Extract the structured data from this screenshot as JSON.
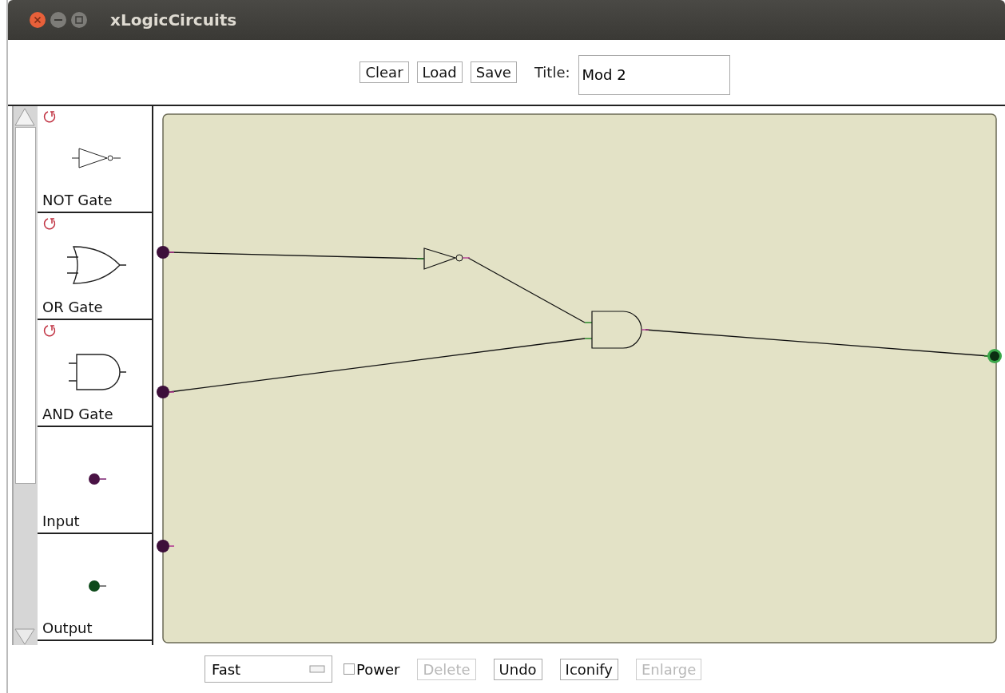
{
  "window": {
    "title": "xLogicCircuits"
  },
  "toolbar": {
    "buttons": [
      "Clear",
      "Load",
      "Save"
    ],
    "title_label": "Title:",
    "title_value": "Mod 2"
  },
  "palette": [
    {
      "kind": "not",
      "label": "NOT Gate",
      "rotatable": true
    },
    {
      "kind": "or",
      "label": "OR Gate",
      "rotatable": true
    },
    {
      "kind": "and",
      "label": "AND Gate",
      "rotatable": true
    },
    {
      "kind": "input",
      "label": "Input",
      "rotatable": false
    },
    {
      "kind": "output",
      "label": "Output",
      "rotatable": false
    }
  ],
  "bottom_bar": {
    "speed": "Fast",
    "power": {
      "label": "Power",
      "checked": false
    },
    "buttons": [
      {
        "label": "Delete",
        "disabled": true
      },
      {
        "label": "Undo",
        "disabled": false
      },
      {
        "label": "Iconify",
        "disabled": false
      },
      {
        "label": "Enlarge",
        "disabled": true
      }
    ]
  }
}
